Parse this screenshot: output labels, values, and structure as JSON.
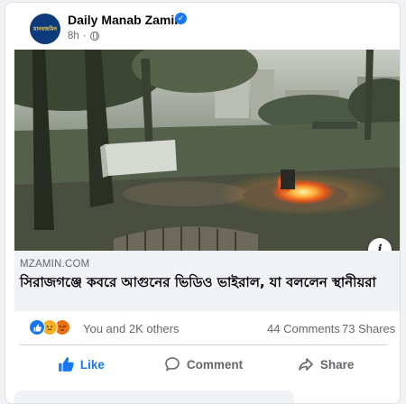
{
  "post": {
    "page_name": "Daily Manab Zamin",
    "avatar_text": "মানবজমিন",
    "time": "8h",
    "separator": "·"
  },
  "link": {
    "domain": "MZAMIN.COM",
    "title": "সিরাজগঞ্জে কবরে আগুনের ভিডিও ভাইরাল, যা বললেন স্থানীয়রা"
  },
  "reactions": {
    "summary": "You and 2K others",
    "comments": "44 Comments",
    "shares": "73 Shares"
  },
  "actions": {
    "like": "Like",
    "comment": "Comment",
    "share": "Share"
  },
  "icons": {
    "verified": "verified-badge-icon",
    "privacy": "globe-icon",
    "info": "info-icon"
  },
  "colors": {
    "accent": "#1877f2",
    "secondary_text": "#65676b",
    "link_box": "#f0f2f5"
  }
}
